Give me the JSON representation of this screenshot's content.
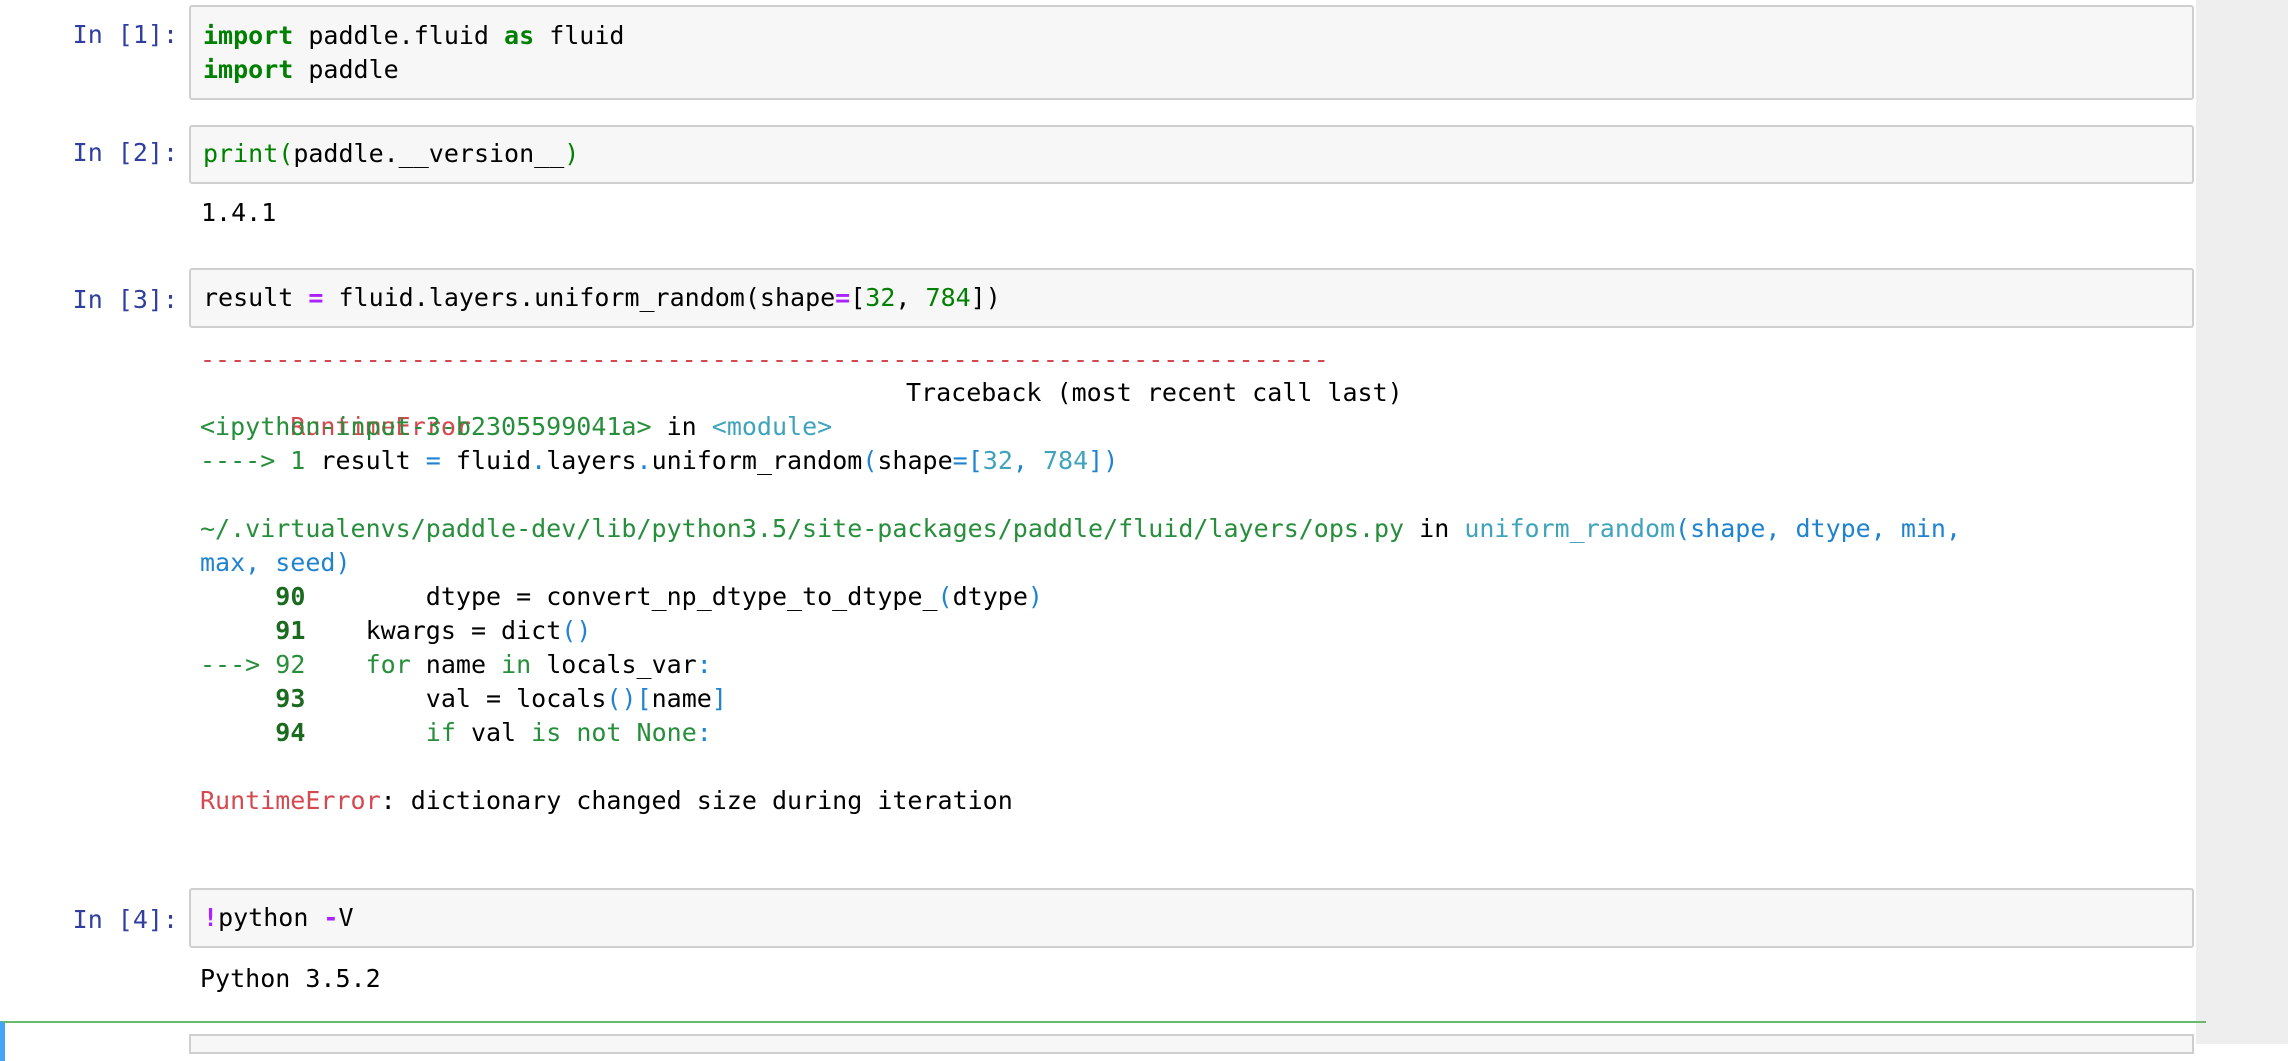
{
  "cells": [
    {
      "prompt": "In [1]:",
      "code": [
        {
          "kw": "import",
          "rest": " paddle.fluid ",
          "kw2": "as",
          "rest2": " fluid"
        },
        {
          "kw": "import",
          "rest": " paddle"
        }
      ]
    },
    {
      "prompt": "In [2]:",
      "code": {
        "fn": "print",
        "open": "(",
        "arg": "paddle.__version__",
        "close": ")"
      },
      "output": "1.4.1"
    },
    {
      "prompt": "In [3]:",
      "code": {
        "a": "result ",
        "eq": "=",
        "b": " fluid.layers.uniform_random(shape",
        "eq2": "=",
        "c": "[",
        "n1": "32",
        "d": ", ",
        "n2": "784",
        "e": "])"
      },
      "traceback": {
        "dashes": "---------------------------------------------------------------------------",
        "error_name": "RuntimeError",
        "header_right": "Traceback (most recent call last)",
        "input_ref": "<ipython-input-3-b2305599041a>",
        "in_word": " in ",
        "module": "<module>",
        "arrow_line": {
          "arrow": "----> 1 ",
          "a": "result ",
          "eq": "=",
          "b": " fluid",
          "dot1": ".",
          "c": "layers",
          "dot2": ".",
          "d": "uniform_random",
          "p1": "(",
          "e": "shape",
          "eq2": "=",
          "br": "[",
          "n1": "32",
          "sep": ", ",
          "n2": "784",
          "close": "])"
        },
        "file_path": "~/.virtualenvs/paddle-dev/lib/python3.5/site-packages/paddle/fluid/layers/ops.py",
        "in_word2": " in ",
        "func": "uniform_random",
        "sig_open": "(",
        "sig_args_1": "shape, dtype, min,",
        "sig_args_2": "max, seed)",
        "lines": [
          {
            "no": "90",
            "prefix": "     ",
            "indent": "        ",
            "text": "dtype = convert_np_dtype_to_dtype_",
            "p": "(",
            "arg": "dtype",
            "pc": ")"
          },
          {
            "no": "91",
            "prefix": "     ",
            "indent": "    ",
            "text": "kwargs = dict",
            "p": "()"
          },
          {
            "no": "92",
            "prefix": "---> ",
            "indent": "    ",
            "kw": "for",
            "text": " name ",
            "kw2": "in",
            "text2": " locals_var",
            "colon": ":"
          },
          {
            "no": "93",
            "prefix": "     ",
            "indent": "        ",
            "text": "val = locals",
            "p": "()",
            "b1": "[",
            "arg": "name",
            "b2": "]"
          },
          {
            "no": "94",
            "prefix": "     ",
            "indent": "        ",
            "kw": "if",
            "text": " val ",
            "kw2": "is not",
            "text2": " None",
            "colon": ":"
          }
        ],
        "final_error_name": "RuntimeError",
        "final_message": ": dictionary changed size during iteration"
      }
    },
    {
      "prompt": "In [4]:",
      "code": {
        "bang": "!",
        "a": "python ",
        "dash": "-",
        "b": "V"
      },
      "output": "Python 3.5.2"
    }
  ],
  "colors": {
    "prompt": "#303f9f",
    "keyword": "#008000",
    "operator": "#aa22ff",
    "error_red": "#d44950",
    "traceback_green": "#278e3b",
    "traceback_cyan": "#3fa4bb",
    "traceback_blue": "#1f83d0"
  }
}
